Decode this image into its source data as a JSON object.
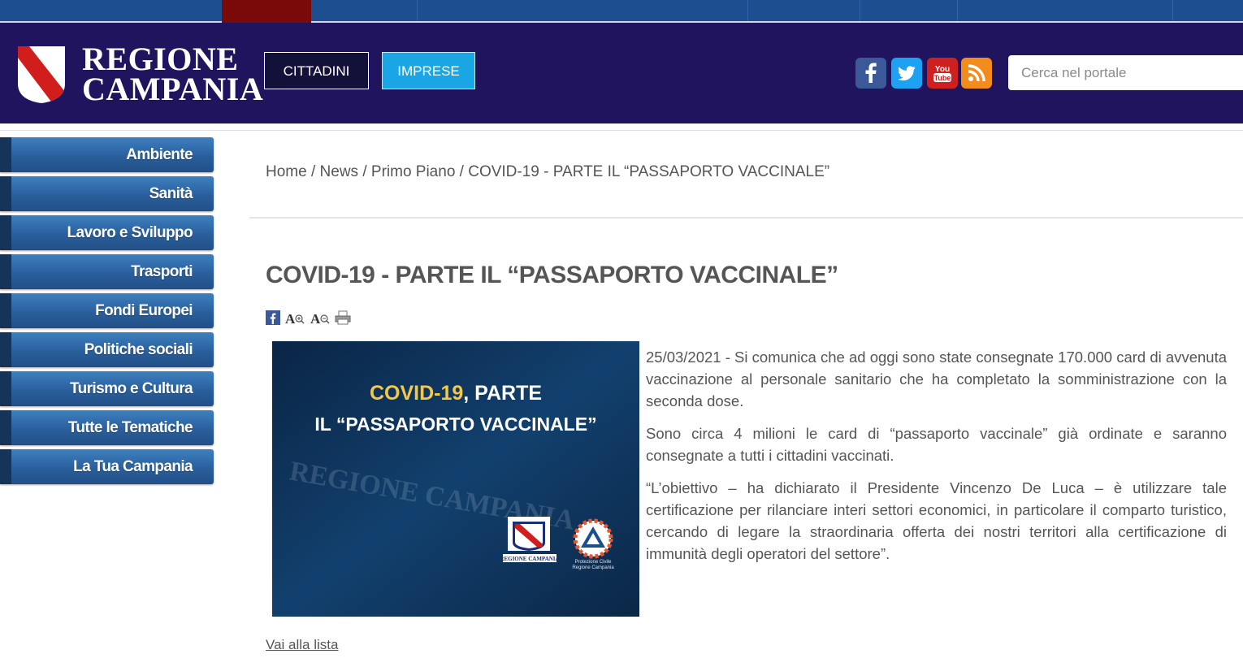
{
  "header": {
    "logo_line1": "REGIONE",
    "logo_line2": "CAMPANIA",
    "btn_cittadini": "CITTADINI",
    "btn_imprese": "IMPRESE",
    "social": [
      "facebook-icon",
      "twitter-icon",
      "youtube-icon",
      "rss-icon"
    ],
    "search_placeholder": "Cerca nel portale"
  },
  "sidebar": {
    "items": [
      {
        "label": "Ambiente"
      },
      {
        "label": "Sanità"
      },
      {
        "label": "Lavoro e Sviluppo"
      },
      {
        "label": "Trasporti"
      },
      {
        "label": "Fondi Europei"
      },
      {
        "label": "Politiche sociali"
      },
      {
        "label": "Turismo e Cultura"
      },
      {
        "label": "Tutte le Tematiche"
      },
      {
        "label": "La Tua Campania"
      }
    ]
  },
  "breadcrumb": {
    "home": "Home",
    "news": "News",
    "primo_piano": "Primo Piano",
    "current": "COVID-19 - PARTE IL “PASSAPORTO VACCINALE”",
    "sep": "/"
  },
  "article": {
    "title": "COVID-19 - PARTE IL “PASSAPORTO VACCINALE”",
    "tools": [
      "facebook-share-icon",
      "font-increase-icon",
      "font-decrease-icon",
      "print-icon"
    ],
    "image": {
      "line1_prefix": "COVID-19",
      "line1_suffix": ", PARTE",
      "line2": "IL “PASSAPORTO VACCINALE”",
      "watermark": "REGIONE CAMPANIA",
      "logo1_caption": "REGIONE CAMPANIA",
      "logo2_caption_1": "Protezione Civile",
      "logo2_caption_2": "Regione Campania"
    },
    "paragraphs": [
      "25/03/2021 - Si comunica che ad oggi sono state consegnate 170.000 card di avvenuta vaccinazione al personale sanitario che ha completato la somministrazione con la seconda dose.",
      "Sono circa 4 milioni le card di “passaporto vaccinale” già ordinate e saranno consegnate a tutti i cittadini vaccinati.",
      "“L’obiettivo – ha dichiarato il Presidente Vincenzo De Luca – è utilizzare tale certificazione per rilanciare interi settori economici, in particolare il comparto turistico, cercando di legare la straordinaria offerta dei nostri territori alla certificazione di immunità degli operatori del settore”."
    ],
    "back_link": "Vai alla lista"
  },
  "colors": {
    "header_bg": "#21145f",
    "top_strip": "#1d4e8f",
    "accent_red": "#7a0a0a",
    "imprese_btn": "#1aa6e4",
    "sidebar_item": "#2a5f9c",
    "image_bg": "#0d2d52",
    "image_title_yellow": "#f2c94c"
  }
}
